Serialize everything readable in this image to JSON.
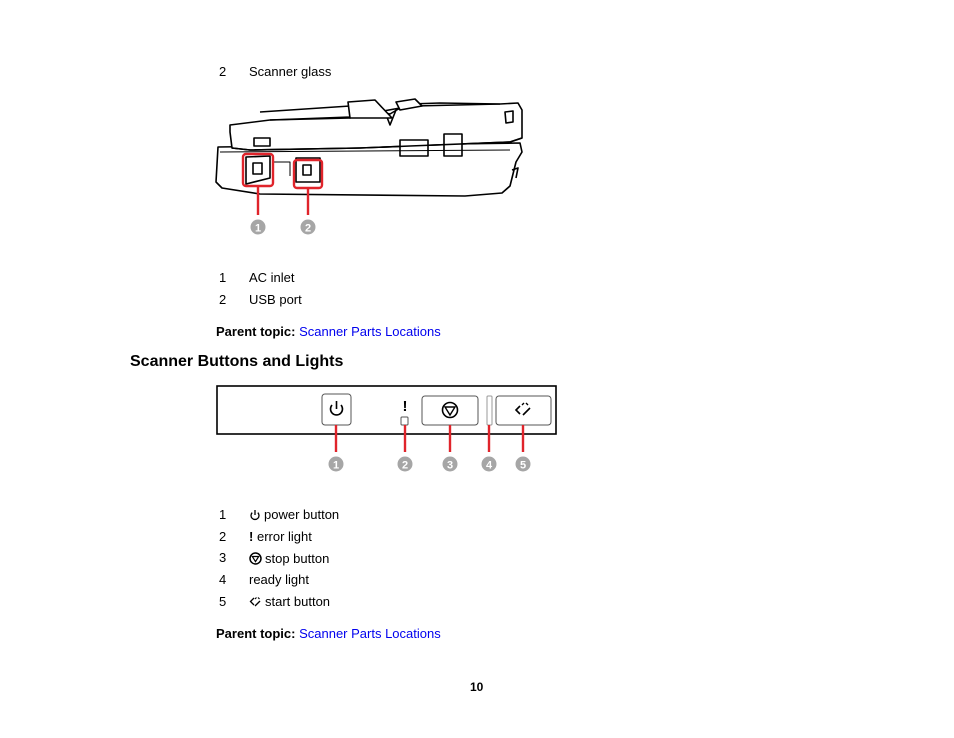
{
  "top_item": {
    "number": "2",
    "label": "Scanner glass"
  },
  "rear_figure": {
    "callouts": [
      "1",
      "2"
    ],
    "callout_color": "#e0242b",
    "badge_color": "#a6a6a6"
  },
  "rear_list": [
    {
      "number": "1",
      "label": "AC inlet"
    },
    {
      "number": "2",
      "label": "USB port"
    }
  ],
  "parent_topic_1": {
    "label": "Parent topic:",
    "link": "Scanner Parts Locations"
  },
  "section_title": "Scanner Buttons and Lights",
  "panel_figure": {
    "callouts": [
      "1",
      "2",
      "3",
      "4",
      "5"
    ],
    "error_glyph": "!"
  },
  "panel_list": [
    {
      "number": "1",
      "icon": "power-icon",
      "label": "power button"
    },
    {
      "number": "2",
      "icon": "exclamation-icon",
      "glyph": "!",
      "label": "error light"
    },
    {
      "number": "3",
      "icon": "stop-icon",
      "label": "stop button"
    },
    {
      "number": "4",
      "icon": "",
      "label": "ready light"
    },
    {
      "number": "5",
      "icon": "start-icon",
      "label": "start button"
    }
  ],
  "parent_topic_2": {
    "label": "Parent topic:",
    "link": "Scanner Parts Locations"
  },
  "page_number": "10"
}
